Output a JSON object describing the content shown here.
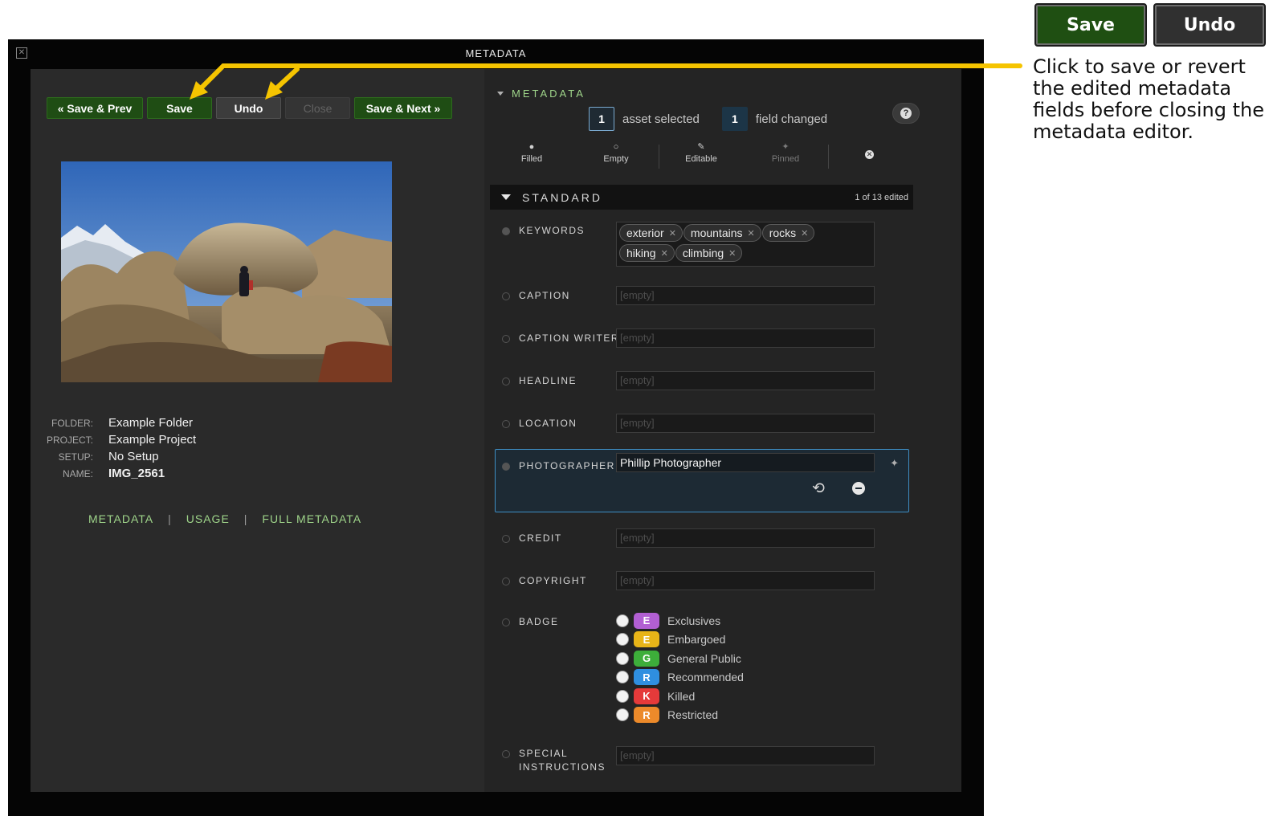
{
  "callout": {
    "save_label": "Save",
    "undo_label": "Undo",
    "text": "Click to save or revert the edited metadata fields before closing the metadata editor."
  },
  "window": {
    "title": "METADATA",
    "close_glyph": "✕"
  },
  "toolbar": {
    "save_prev": "«  Save & Prev",
    "save": "Save",
    "undo": "Undo",
    "close": "Close",
    "save_next": "Save & Next  »"
  },
  "asset_info": [
    {
      "label": "FOLDER:",
      "value": "Example Folder"
    },
    {
      "label": "PROJECT:",
      "value": "Example Project"
    },
    {
      "label": "SETUP:",
      "value": "No Setup"
    },
    {
      "label": "NAME:",
      "value": "IMG_2561"
    }
  ],
  "bottom_nav": {
    "metadata": "METADATA",
    "usage": "USAGE",
    "full_metadata": "FULL METADATA",
    "separator": "|"
  },
  "metadata_panel": {
    "header": "METADATA",
    "asset_count": "1",
    "asset_label": "asset selected",
    "field_count": "1",
    "field_label": "field changed",
    "help_glyph": "?",
    "filters": {
      "filled": "Filled",
      "empty": "Empty",
      "editable": "Editable",
      "pinned": "Pinned"
    },
    "standard_title": "STANDARD",
    "standard_count": "1 of 13 edited"
  },
  "fields": {
    "keywords_label": "KEYWORDS",
    "keywords": [
      "exterior",
      "mountains",
      "rocks",
      "hiking",
      "climbing"
    ],
    "caption_label": "CAPTION",
    "caption_writer_label": "CAPTION WRITER",
    "headline_label": "HEADLINE",
    "location_label": "LOCATION",
    "photographer_label": "PHOTOGRAPHER",
    "photographer_value": "Phillip Photographer",
    "credit_label": "CREDIT",
    "copyright_label": "COPYRIGHT",
    "badge_label": "BADGE",
    "special_label_1": "SPECIAL",
    "special_label_2": "INSTRUCTIONS",
    "empty_placeholder": "[empty]"
  },
  "badges": [
    {
      "letter": "E",
      "label": "Exclusives",
      "color": "#b25fd3"
    },
    {
      "letter": "E",
      "label": "Embargoed",
      "color": "#e8b418"
    },
    {
      "letter": "G",
      "label": "General Public",
      "color": "#3dae3a"
    },
    {
      "letter": "R",
      "label": "Recommended",
      "color": "#2f8fe0"
    },
    {
      "letter": "K",
      "label": "Killed",
      "color": "#e53a3a"
    },
    {
      "letter": "R",
      "label": "Restricted",
      "color": "#ec8a2a"
    }
  ],
  "colors": {
    "accent_green": "#9fd58a",
    "button_green": "#1f4d14",
    "callout_arrow": "#f5c400",
    "focus_blue": "#3f8ec4"
  }
}
